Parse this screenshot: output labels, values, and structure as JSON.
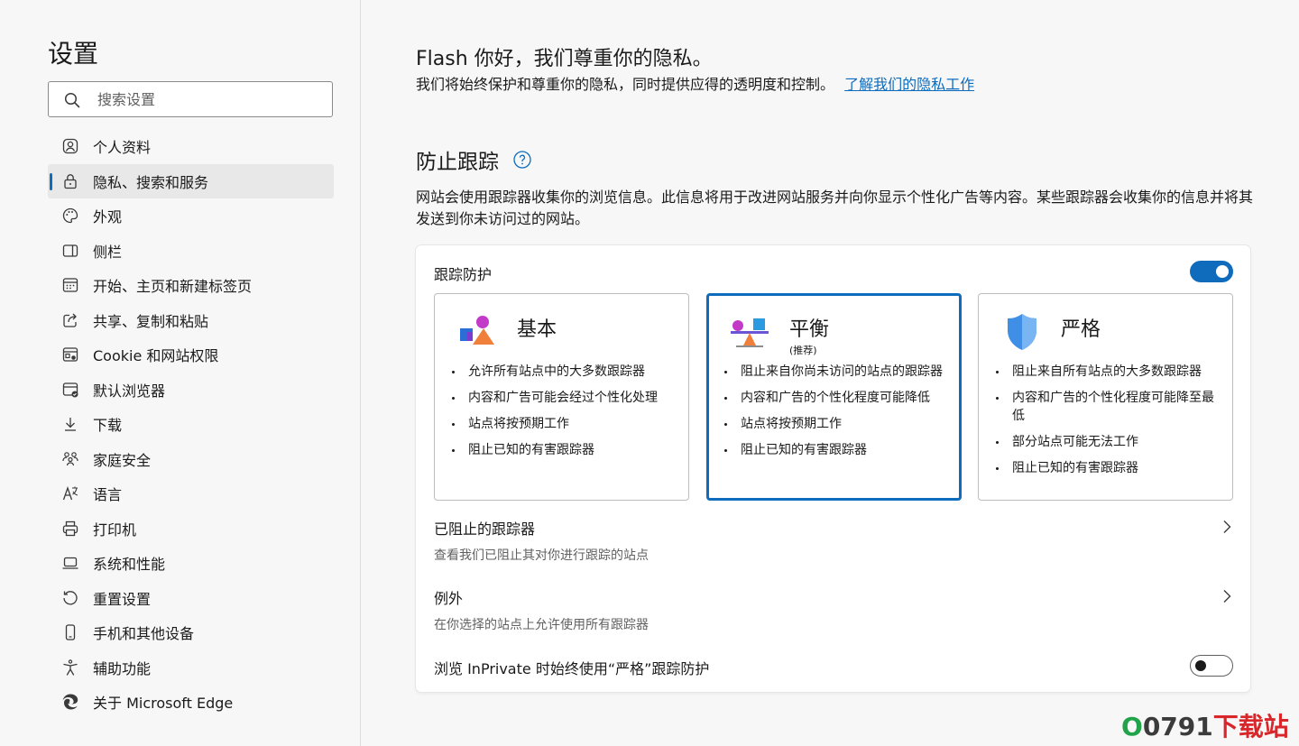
{
  "sidebar": {
    "title": "设置",
    "search_placeholder": "搜索设置",
    "items": [
      {
        "label": "个人资料",
        "icon": "profile-icon"
      },
      {
        "label": "隐私、搜索和服务",
        "icon": "lock-icon",
        "active": true
      },
      {
        "label": "外观",
        "icon": "palette-icon"
      },
      {
        "label": "侧栏",
        "icon": "sidebar-icon"
      },
      {
        "label": "开始、主页和新建标签页",
        "icon": "home-grid-icon"
      },
      {
        "label": "共享、复制和粘贴",
        "icon": "share-icon"
      },
      {
        "label": "Cookie 和网站权限",
        "icon": "cookie-site-icon"
      },
      {
        "label": "默认浏览器",
        "icon": "default-browser-icon"
      },
      {
        "label": "下载",
        "icon": "download-icon"
      },
      {
        "label": "家庭安全",
        "icon": "family-icon"
      },
      {
        "label": "语言",
        "icon": "language-icon"
      },
      {
        "label": "打印机",
        "icon": "printer-icon"
      },
      {
        "label": "系统和性能",
        "icon": "laptop-icon"
      },
      {
        "label": "重置设置",
        "icon": "reset-icon"
      },
      {
        "label": "手机和其他设备",
        "icon": "phone-icon"
      },
      {
        "label": "辅助功能",
        "icon": "accessibility-icon"
      },
      {
        "label": "关于 Microsoft Edge",
        "icon": "edge-icon"
      }
    ]
  },
  "main": {
    "greeting": "Flash 你好，我们尊重你的隐私。",
    "intro_text": "我们将始终保护和尊重你的隐私，同时提供应得的透明度和控制。",
    "intro_link": "了解我们的隐私工作",
    "tracking": {
      "title": "防止跟踪",
      "description": "网站会使用跟踪器收集你的浏览信息。此信息将用于改进网站服务并向你显示个性化广告等内容。某些跟踪器会收集你的信息并将其发送到你未访问过的网站。",
      "toggle_label": "跟踪防护",
      "toggle_on": true,
      "levels": [
        {
          "title": "基本",
          "subtitle": "",
          "selected": false,
          "bullets": [
            "允许所有站点中的大多数跟踪器",
            "内容和广告可能会经过个性化处理",
            "站点将按预期工作",
            "阻止已知的有害跟踪器"
          ]
        },
        {
          "title": "平衡",
          "subtitle": "(推荐)",
          "selected": true,
          "bullets": [
            "阻止来自你尚未访问的站点的跟踪器",
            "内容和广告的个性化程度可能降低",
            "站点将按预期工作",
            "阻止已知的有害跟踪器"
          ]
        },
        {
          "title": "严格",
          "subtitle": "",
          "selected": false,
          "bullets": [
            "阻止来自所有站点的大多数跟踪器",
            "内容和广告的个性化程度可能降至最低",
            "部分站点可能无法工作",
            "阻止已知的有害跟踪器"
          ]
        }
      ],
      "blocked": {
        "title": "已阻止的跟踪器",
        "subtitle": "查看我们已阻止其对你进行跟踪的站点"
      },
      "exceptions": {
        "title": "例外",
        "subtitle": "在你选择的站点上允许使用所有跟踪器"
      },
      "inprivate": {
        "label": "浏览 InPrivate 时始终使用“严格”跟踪防护",
        "toggle_on": false
      }
    }
  },
  "watermark": {
    "o": "O",
    "num": "0791",
    "text": "下载站"
  },
  "colors": {
    "accent": "#0f6cbd",
    "background": "#f7f7f7",
    "card": "#ffffff"
  }
}
